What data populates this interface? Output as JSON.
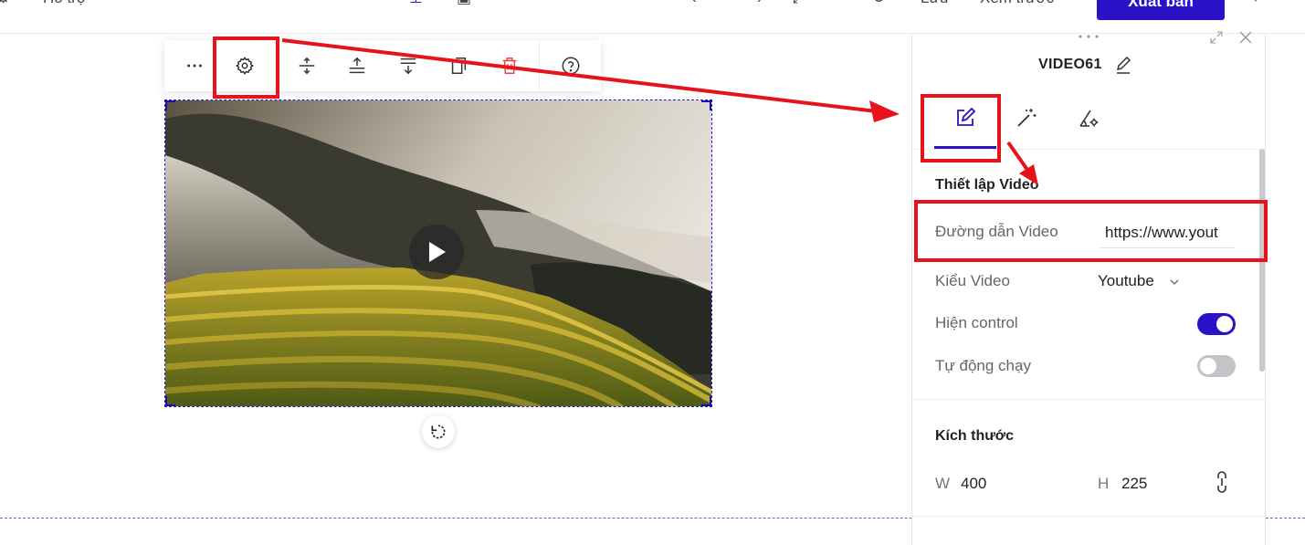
{
  "topbar": {
    "support_label": "Hỗ trợ",
    "save_label": "Lưu",
    "preview_label": "Xem trước",
    "publish_label": "Xuất bản"
  },
  "toolbar": {
    "icons": [
      "more-icon",
      "settings-icon",
      "move-icon",
      "move-up-icon",
      "move-down-icon",
      "duplicate-icon",
      "delete-icon",
      "help-icon"
    ]
  },
  "panel": {
    "element_name": "VIDEO61",
    "tabs": [
      "edit-tab",
      "effects-tab",
      "advanced-tab"
    ],
    "video_settings_heading": "Thiết lập Video",
    "url_label": "Đường dẫn Video",
    "url_value": "https://www.yout",
    "type_label": "Kiểu Video",
    "type_value": "Youtube",
    "controls_label": "Hiện control",
    "controls_on": true,
    "autoplay_label": "Tự động chạy",
    "autoplay_on": false,
    "size_heading": "Kích thước",
    "width_label": "W",
    "width_value": "400",
    "height_label": "H",
    "height_value": "225"
  },
  "colors": {
    "accent": "#2a12c9",
    "annotation": "#e8121a",
    "delete": "#e8433a"
  }
}
